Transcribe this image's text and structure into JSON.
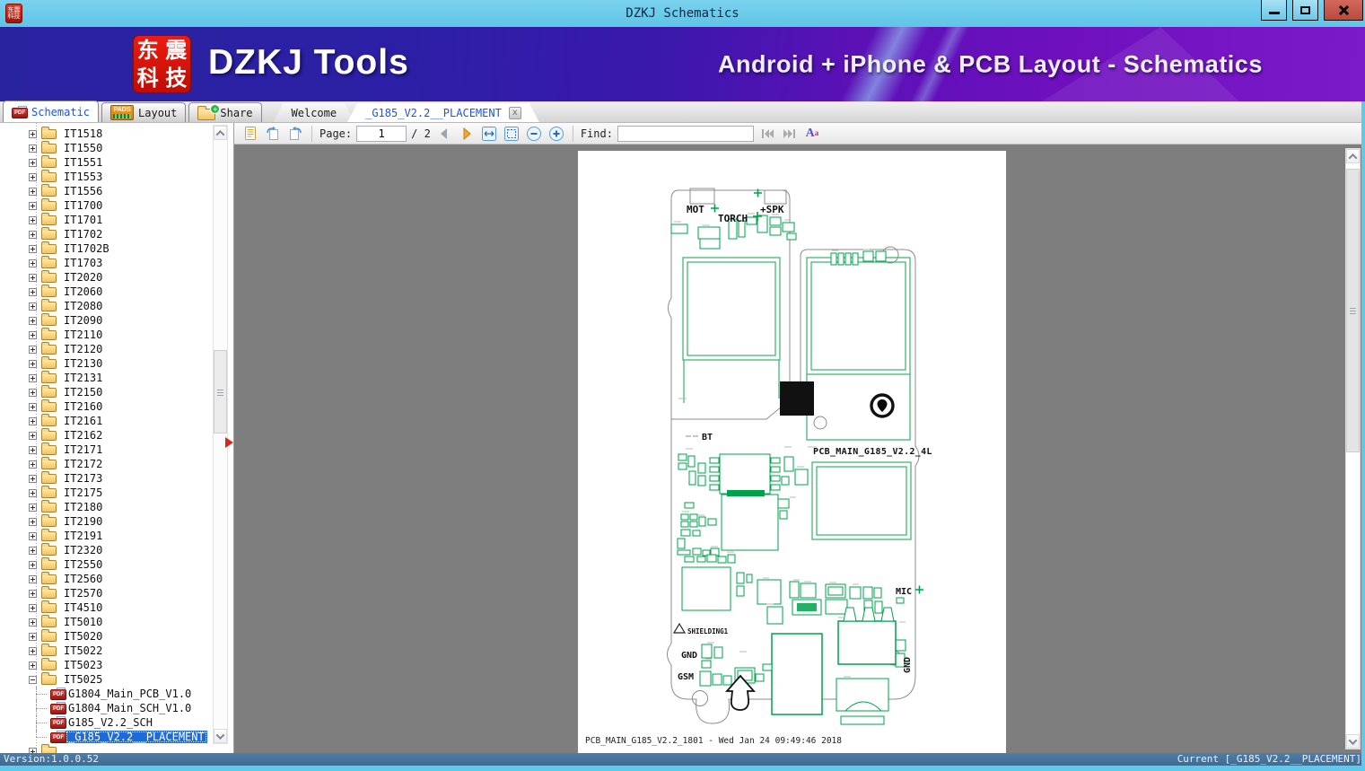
{
  "window": {
    "title": "DZKJ Schematics"
  },
  "banner": {
    "logo_chars": [
      "东",
      "震",
      "科",
      "技"
    ],
    "brand": "DZKJ Tools",
    "tagline": "Android + iPhone & PCB Layout - Schematics"
  },
  "icons": {
    "pdf_badge": "PDF",
    "pads_badge": "PADS",
    "plus": "+",
    "close": "x",
    "font_large": "A",
    "font_small": "a"
  },
  "tabs": {
    "schematic": "Schematic",
    "layout": "Layout",
    "share": "Share",
    "welcome": "Welcome",
    "placement": "_G185_V2.2__PLACEMENT"
  },
  "toolbar": {
    "page_label": "Page:",
    "page_value": "1",
    "page_total": "/ 2",
    "find_label": "Find:",
    "find_value": ""
  },
  "sidebar": {
    "folders": [
      "IT1518",
      "IT1550",
      "IT1551",
      "IT1553",
      "IT1556",
      "IT1700",
      "IT1701",
      "IT1702",
      "IT1702B",
      "IT1703",
      "IT2020",
      "IT2060",
      "IT2080",
      "IT2090",
      "IT2110",
      "IT2120",
      "IT2130",
      "IT2131",
      "IT2150",
      "IT2160",
      "IT2161",
      "IT2162",
      "IT2171",
      "IT2172",
      "IT2173",
      "IT2175",
      "IT2180",
      "IT2190",
      "IT2191",
      "IT2320",
      "IT2550",
      "IT2560",
      "IT2570",
      "IT4510",
      "IT5010",
      "IT5020",
      "IT5022",
      "IT5023",
      "IT5025"
    ],
    "expanded": "IT5025",
    "documents": [
      {
        "label": "G1804_Main_PCB_V1.0",
        "selected": false
      },
      {
        "label": "G1804_Main_SCH_V1.0",
        "selected": false
      },
      {
        "label": "G185_V2.2_SCH",
        "selected": false
      },
      {
        "label": "_G185_V2.2__PLACEMENT",
        "selected": true
      }
    ]
  },
  "pcb": {
    "mot": "MOT",
    "torch": "TORCH",
    "spk": "+SPK",
    "bt": "BT",
    "board_name": "PCB_MAIN_G185_V2.2_4L",
    "mic": "MIC",
    "shielding": "SHIELDING1",
    "gnd_left": "GND",
    "gsm": "GSM",
    "gnd_right": "GND",
    "footer": "PCB_MAIN_G185_V2.2_1801 - Wed Jan 24 09:49:46 2018"
  },
  "statusbar": {
    "version": "Version:1.0.0.52",
    "current": "Current [_G185_V2.2__PLACEMENT]"
  },
  "colors": {
    "titlebar": "#68CAEA",
    "banner_left": "#2B22A6",
    "banner_right": "#7412C2",
    "green": "#00A14B",
    "selection": "#1E6AD8",
    "status_bar": "#44719B",
    "close_button": "#C4574C"
  }
}
